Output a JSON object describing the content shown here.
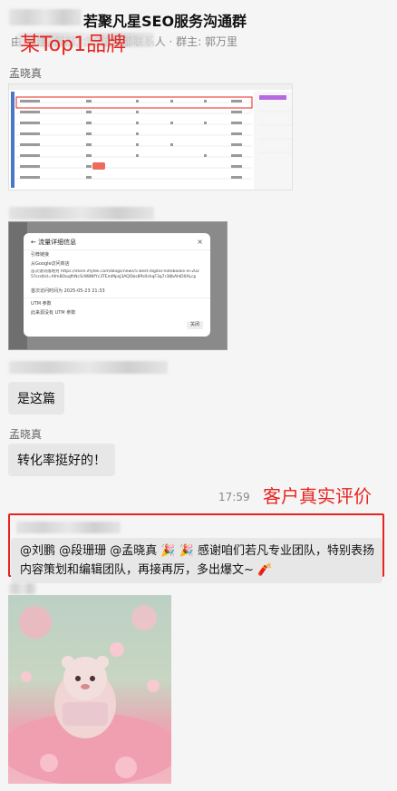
{
  "header": {
    "title": "若聚凡星SEO服务沟通群",
    "subtitle": "由     创建,      部部, 含9位外部联系人 · 群主: 郭万里",
    "annotation": "某Top1品牌"
  },
  "messages": {
    "m1": {
      "sender": "孟晓真"
    },
    "m2": {
      "dialog_title": "流量详细信息",
      "row1": "引荐链接",
      "row2": "从Google访问商店",
      "row3": "首次访问落地为 https://store.iflytek.com/blogs/news/5-best-digital-notebooks-in-2025?srsltid=AfmBOoqfhNcSrW8NfYc3TEmMpsJ3AQObs8Ps0shqF3q7r38bAhlD0ALcp",
      "row4": "首次访问时间为 2025-05-23 21:33",
      "utm_title": "UTM 参数",
      "utm_body": "此来源没有 UTM 参数",
      "close_label": "关闭"
    },
    "m3": {
      "text": "是这篇"
    },
    "m4": {
      "sender": "孟晓真",
      "text": "转化率挺好的！"
    },
    "m5": {
      "time": "17:59",
      "annotation": "客户真实评价",
      "line1": "@刘鹏 @段珊珊 @孟晓真 🎉 🎉 感谢咱们若凡专业团队，特别表扬",
      "line2": "内容策划和编辑团队，再接再厉，多出爆文~ 🧨"
    }
  },
  "colors": {
    "accent_red": "#e8231f",
    "bubble": "#e7e7e7",
    "background": "#f5f5f5"
  }
}
